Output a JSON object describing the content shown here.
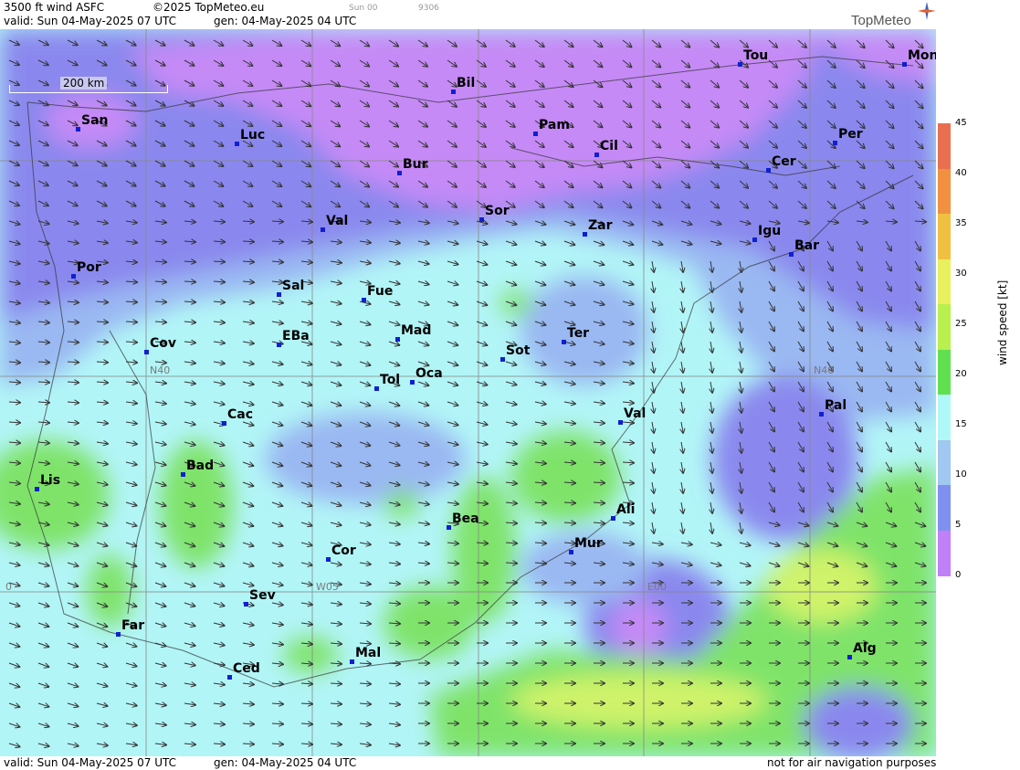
{
  "header": {
    "product": "3500 ft wind ASFC",
    "copyright": "©2025 TopMeteo.eu",
    "valid": "valid:  Sun  04-May-2025  07 UTC",
    "gen": "gen: 04-May-2025 04 UTC",
    "run": "Sun 00",
    "code": "9306",
    "logo": "TopMeteo"
  },
  "footer": {
    "valid": "valid:  Sun  04-May-2025  07 UTC",
    "gen": "gen: 04-May-2025 04 UTC",
    "disclaimer": "not for air navigation purposes"
  },
  "scale_bar": "200 km",
  "grid_labels": {
    "n40": "N40",
    "w05": "W05",
    "e00": "E00",
    "w10": "0"
  },
  "legend": {
    "unit": "wind speed [kt]",
    "ticks": [
      "45",
      "40",
      "35",
      "30",
      "25",
      "20",
      "15",
      "10",
      "5",
      "0"
    ],
    "colors": [
      "#e87050",
      "#f09040",
      "#f0c040",
      "#e8f060",
      "#b8f050",
      "#60e050",
      "#b0f8f8",
      "#a0c8f0",
      "#8090f0",
      "#c080f8"
    ]
  },
  "colors": {
    "purple": "#c58af6",
    "violet": "#8a88ee",
    "blue": "#9ab8f2",
    "cyan": "#b2f5f7",
    "green": "#7fe36a",
    "yellowgreen": "#cff36a"
  },
  "cities": [
    {
      "name": "San"
    },
    {
      "name": "Luc"
    },
    {
      "name": "Bil"
    },
    {
      "name": "Pam"
    },
    {
      "name": "Cil"
    },
    {
      "name": "Tou"
    },
    {
      "name": "Mon"
    },
    {
      "name": "Per"
    },
    {
      "name": "Cer"
    },
    {
      "name": "Bur"
    },
    {
      "name": "Val"
    },
    {
      "name": "Sor"
    },
    {
      "name": "Zar"
    },
    {
      "name": "Igu"
    },
    {
      "name": "Bar"
    },
    {
      "name": "Por"
    },
    {
      "name": "Sal"
    },
    {
      "name": "Fue"
    },
    {
      "name": "Cov"
    },
    {
      "name": "EBa"
    },
    {
      "name": "Mad"
    },
    {
      "name": "Sot"
    },
    {
      "name": "Ter"
    },
    {
      "name": "Tol"
    },
    {
      "name": "Oca"
    },
    {
      "name": "Pal"
    },
    {
      "name": "Cac"
    },
    {
      "name": "Val"
    },
    {
      "name": "Lis"
    },
    {
      "name": "Bad"
    },
    {
      "name": "Ali"
    },
    {
      "name": "Bea"
    },
    {
      "name": "Cor"
    },
    {
      "name": "Mur"
    },
    {
      "name": "Sev"
    },
    {
      "name": "Far"
    },
    {
      "name": "Alg"
    },
    {
      "name": "Mal"
    },
    {
      "name": "Ced"
    }
  ]
}
